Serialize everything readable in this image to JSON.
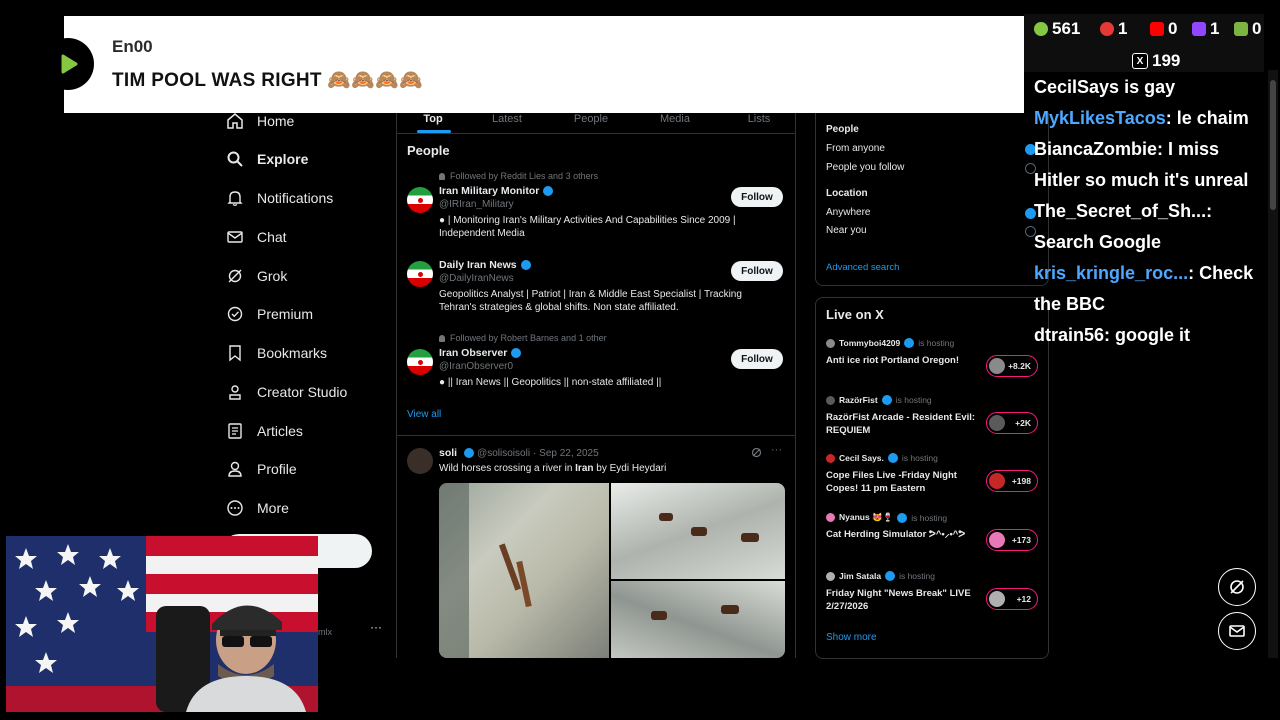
{
  "banner": {
    "username": "En00",
    "message": "TIM POOL WAS RIGHT 🙈🙈🙈🙈"
  },
  "nav": {
    "items": [
      {
        "label": "Home",
        "icon": "home-icon"
      },
      {
        "label": "Explore",
        "icon": "search-icon"
      },
      {
        "label": "Notifications",
        "icon": "bell-icon"
      },
      {
        "label": "Chat",
        "icon": "mail-icon"
      },
      {
        "label": "Grok",
        "icon": "grok-icon"
      },
      {
        "label": "Premium",
        "icon": "premium-icon"
      },
      {
        "label": "Bookmarks",
        "icon": "bookmark-icon"
      },
      {
        "label": "Creator Studio",
        "icon": "creator-icon"
      },
      {
        "label": "Articles",
        "icon": "articles-icon"
      },
      {
        "label": "Profile",
        "icon": "person-icon"
      },
      {
        "label": "More",
        "icon": "more-icon"
      }
    ],
    "account_handle_partial": "mlx",
    "account_more": "···"
  },
  "tabs": [
    {
      "label": "Top",
      "active": true
    },
    {
      "label": "Latest",
      "active": false
    },
    {
      "label": "People",
      "active": false
    },
    {
      "label": "Media",
      "active": false
    },
    {
      "label": "Lists",
      "active": false
    }
  ],
  "people": {
    "heading": "People",
    "follow_label": "Follow",
    "view_all": "View all",
    "accounts": [
      {
        "context": "Followed by Reddit Lies and 3 others",
        "name": "Iran Military Monitor",
        "handle": "@IRIran_Military",
        "bio": "● | Monitoring Iran's Military Activities And Capabilities Since 2009 | Independent Media"
      },
      {
        "context": "",
        "name": "Daily Iran News",
        "handle": "@DailyIranNews",
        "bio": "Geopolitics Analyst | Patriot | Iran & Middle East Specialist | Tracking Tehran's strategies & global shifts. Non state affiliated."
      },
      {
        "context": "Followed by Robert Barnes and 1 other",
        "name": "Iran Observer",
        "handle": "@IranObserver0",
        "bio": "● || Iran News || Geopolitics || non-state affiliated ||"
      }
    ]
  },
  "post": {
    "name": "soli",
    "handle": "@solisoisoli",
    "date": "· Sep 22, 2025",
    "text_before": "Wild horses crossing a river in ",
    "text_bold": "Iran",
    "text_after": " by Eydi Heydari"
  },
  "search_filters": {
    "people_heading": "People",
    "from_anyone": "From anyone",
    "people_you_follow": "People you follow",
    "location_heading": "Location",
    "anywhere": "Anywhere",
    "near_you": "Near you",
    "advanced_search": "Advanced search"
  },
  "live": {
    "heading": "Live on X",
    "hosting": "is hosting",
    "show_more": "Show more",
    "items": [
      {
        "host": "Tommyboi4209",
        "title": "Anti ice riot Portland Oregon!",
        "count": "+8.2K",
        "color": "#8a8a8a"
      },
      {
        "host": "RazörFist",
        "title": "RazörFist Arcade - Resident Evil: REQUIEM",
        "count": "+2K",
        "color": "#5a5a5a"
      },
      {
        "host": "Cecil Says.",
        "title": "Cope Files Live -Friday Night Copes! 11 pm Eastern",
        "count": "+198",
        "color": "#c62828"
      },
      {
        "host": "Nyanus 😻🍷",
        "title": "Cat Herding Simulator ᕗ^•⸝•^ᕗ",
        "count": "+173",
        "color": "#e879b9"
      },
      {
        "host": "Jim Satala",
        "title": "Friday Night \"News Break\" LIVE 2/27/2026",
        "count": "+12",
        "color": "#b0b0b0"
      }
    ]
  },
  "stats": [
    {
      "icon": "rumble-icon",
      "value": "561",
      "color": "#85c742"
    },
    {
      "icon": "live-icon",
      "value": "1",
      "color": "#e53935"
    },
    {
      "icon": "youtube-icon",
      "value": "0",
      "color": "#ff0000"
    },
    {
      "icon": "twitch-icon",
      "value": "1",
      "color": "#9146ff"
    },
    {
      "icon": "link-icon",
      "value": "0",
      "color": "#7cb342"
    },
    {
      "icon": "x-icon",
      "value": "199",
      "color": "#ffffff"
    }
  ],
  "chat": [
    {
      "user": "CecilSays",
      "text": " is gay",
      "user_color": "#ffffff",
      "user_only_bold": false,
      "combined": "CecilSays is gay"
    },
    {
      "user": "MykLikesTacos",
      "text": ": le chaim",
      "user_color": "#4fa8ff"
    },
    {
      "user": "BiancaZombie",
      "text": ": I miss Hitler so much it's unreal",
      "user_color": "#ffffff"
    },
    {
      "user": "The_Secret_of_Sh...",
      "text": ": Search Google",
      "user_color": "#ffffff"
    },
    {
      "user": "kris_kringle_roc...",
      "text": ": Check the BBC",
      "user_color": "#4fa8ff"
    },
    {
      "user": "dtrain56",
      "text": ": google it",
      "user_color": "#ffffff"
    }
  ],
  "colors": {
    "accent": "#1d9bf0",
    "live_accent": "#f91880",
    "background": "#000000"
  }
}
